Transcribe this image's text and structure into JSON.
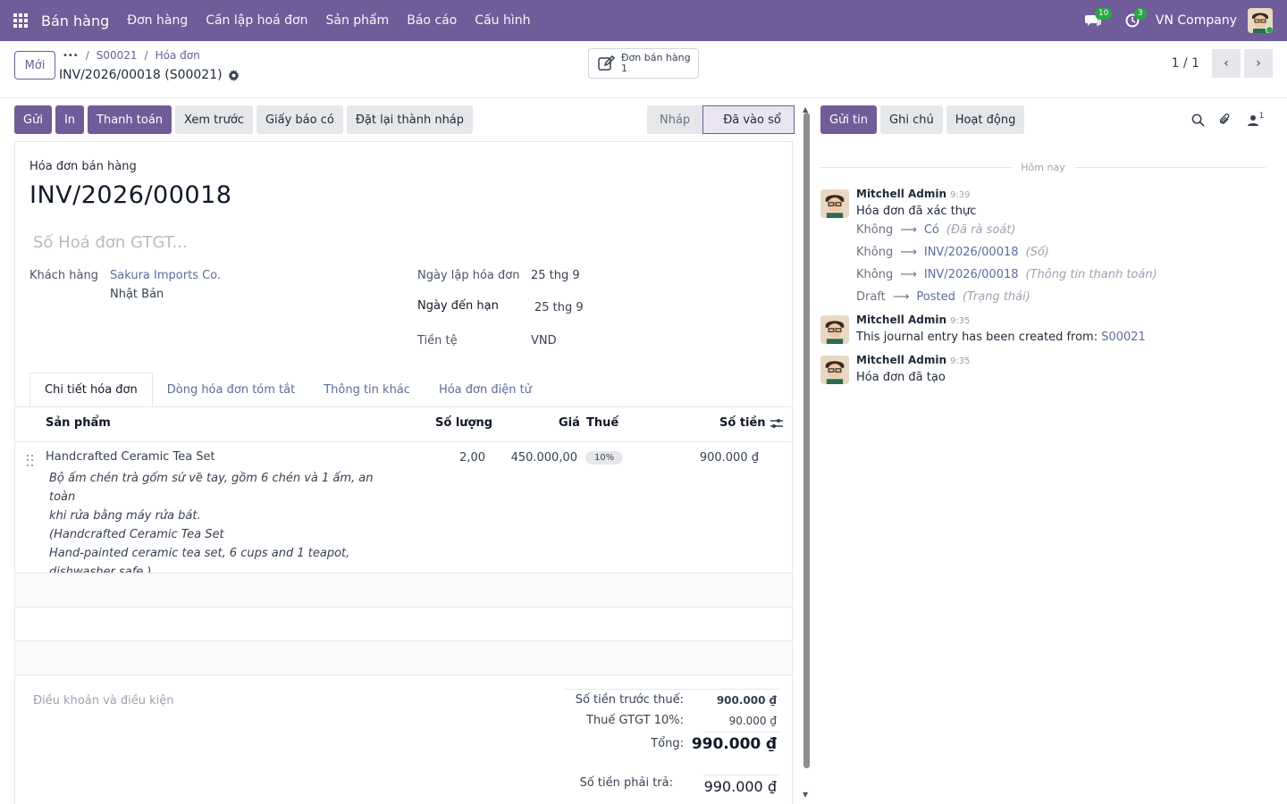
{
  "navbar": {
    "brand": "Bán hàng",
    "menu": [
      "Đơn hàng",
      "Cần lập hoá đơn",
      "Sản phẩm",
      "Báo cáo",
      "Cấu hình"
    ],
    "messages_count": "10",
    "activities_count": "3",
    "company": "VN Company"
  },
  "control": {
    "new_label": "Mới",
    "breadcrumb_more": "•••",
    "breadcrumb": [
      "S00021",
      "Hóa đơn"
    ],
    "record_title": "INV/2026/00018 (S00021)",
    "smart_button_label": "Đơn bán hàng",
    "smart_button_count": "1",
    "pager": "1 / 1"
  },
  "actions": [
    "Gửi",
    "In",
    "Thanh toán",
    "Xem trước",
    "Giấy báo có",
    "Đặt lại thành nháp"
  ],
  "status": {
    "steps": [
      "Nháp",
      "Đã vào sổ"
    ],
    "current": "Đã vào sổ"
  },
  "invoice": {
    "type_label": "Hóa đơn bán hàng",
    "name": "INV/2026/00018",
    "vat_placeholder": "Số Hoá đơn GTGT...",
    "customer_label": "Khách hàng",
    "customer_name": "Sakura Imports Co.",
    "customer_country": "Nhật Bản",
    "invoice_date_label": "Ngày lập hóa đơn",
    "invoice_date": "25 thg 9",
    "due_date_label": "Ngày đến hạn",
    "due_date": "25 thg 9",
    "currency_label": "Tiền tệ",
    "currency": "VND"
  },
  "tabs": [
    "Chi tiết hóa đơn",
    "Dòng hóa đơn tóm tắt",
    "Thông tin khác",
    "Hóa đơn điện tử"
  ],
  "lines": {
    "headers": {
      "product": "Sản phẩm",
      "quantity": "Số lượng",
      "price": "Giá",
      "tax": "Thuế",
      "amount": "Số tiền"
    },
    "rows": [
      {
        "product": "Handcrafted Ceramic Tea Set",
        "description": [
          "Bộ ấm chén trà gốm sứ vẽ tay, gồm 6 chén và 1 ấm, an toàn",
          "khi rửa bằng máy rửa bát.",
          "(Handcrafted Ceramic Tea Set",
          "Hand-painted ceramic tea set, 6 cups and 1 teapot,",
          "dishwasher safe.)"
        ],
        "quantity": "2,00",
        "price": "450.000,00",
        "tax": "10%",
        "amount": "900.000 ₫"
      }
    ]
  },
  "terms_placeholder": "Điều khoản và điều kiện",
  "totals": {
    "untaxed_label": "Số tiền trước thuế:",
    "untaxed": "900.000 ₫",
    "vat_label": "Thuế GTGT 10%:",
    "vat": "90.000 ₫",
    "total_label": "Tổng:",
    "total": "990.000 ₫",
    "due_label": "Số tiền phải trả:",
    "due": "990.000 ₫"
  },
  "chatter": {
    "buttons": [
      "Gửi tin",
      "Ghi chú",
      "Hoạt động"
    ],
    "followers_count": "1",
    "today_label": "Hôm nay",
    "messages": [
      {
        "author": "Mitchell Admin",
        "time": "9:39",
        "text": "Hóa đơn đã xác thực",
        "tracking": [
          {
            "old": "Không",
            "new": "Có",
            "field": "(Đã rà soát)"
          },
          {
            "old": "Không",
            "new": "INV/2026/00018",
            "field": "(Số)"
          },
          {
            "old": "Không",
            "new": "INV/2026/00018",
            "field": "(Thông tin thanh toán)"
          },
          {
            "old": "Draft",
            "new": "Posted",
            "field": "(Trạng thái)"
          }
        ]
      },
      {
        "author": "Mitchell Admin",
        "time": "9:35",
        "text": "This journal entry has been created from: ",
        "link": "S00021"
      },
      {
        "author": "Mitchell Admin",
        "time": "9:35",
        "text": "Hóa đơn đã tạo"
      }
    ]
  },
  "colors": {
    "brand": "#6f5c99",
    "link": "#5e6b9e",
    "badge_green": "#28a745"
  }
}
